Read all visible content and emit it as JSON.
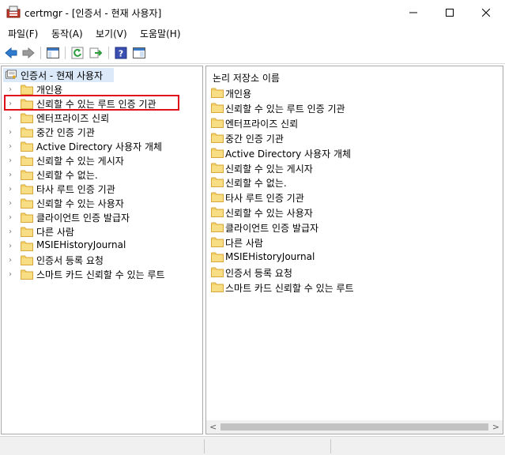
{
  "window": {
    "title": "certmgr - [인증서 - 현재 사용자]"
  },
  "menu": [
    {
      "label": "파일(F)"
    },
    {
      "label": "동작(A)"
    },
    {
      "label": "보기(V)"
    },
    {
      "label": "도움말(H)"
    }
  ],
  "toolbar": {
    "icons": [
      "back-arrow-icon",
      "forward-arrow-icon",
      "show-hide-tree-icon",
      "refresh-icon",
      "export-list-icon",
      "help-icon",
      "properties-icon"
    ]
  },
  "tree": {
    "root": "인증서 - 현재 사용자",
    "items": [
      {
        "label": "개인용"
      },
      {
        "label": "신뢰할 수 있는 루트 인증 기관"
      },
      {
        "label": "엔터프라이즈 신뢰"
      },
      {
        "label": "중간 인증 기관"
      },
      {
        "label": "Active Directory 사용자 개체"
      },
      {
        "label": "신뢰할 수 있는 게시자"
      },
      {
        "label": "신뢰할 수 없는."
      },
      {
        "label": "타사 루트 인증 기관"
      },
      {
        "label": "신뢰할 수 있는 사용자"
      },
      {
        "label": "클라이언트 인증 발급자"
      },
      {
        "label": "다른 사람"
      },
      {
        "label": "MSIEHistoryJournal"
      },
      {
        "label": "인증서 등록 요청"
      },
      {
        "label": "스마트 카드 신뢰할 수 있는 루트"
      }
    ],
    "highlighted_index": 1
  },
  "list": {
    "column_header": "논리 저장소 이름",
    "items": [
      {
        "label": "개인용"
      },
      {
        "label": "신뢰할 수 있는 루트 인증 기관"
      },
      {
        "label": "엔터프라이즈 신뢰"
      },
      {
        "label": "중간 인증 기관"
      },
      {
        "label": "Active Directory 사용자 개체"
      },
      {
        "label": "신뢰할 수 있는 게시자"
      },
      {
        "label": "신뢰할 수 없는."
      },
      {
        "label": "타사 루트 인증 기관"
      },
      {
        "label": "신뢰할 수 있는 사용자"
      },
      {
        "label": "클라이언트 인증 발급자"
      },
      {
        "label": "다른 사람"
      },
      {
        "label": "MSIEHistoryJournal"
      },
      {
        "label": "인증서 등록 요청"
      },
      {
        "label": "스마트 카드 신뢰할 수 있는 루트"
      }
    ]
  },
  "colors": {
    "highlight_border": "#e0101a",
    "folder": "#e8c25a",
    "selection": "#dce9f9"
  }
}
